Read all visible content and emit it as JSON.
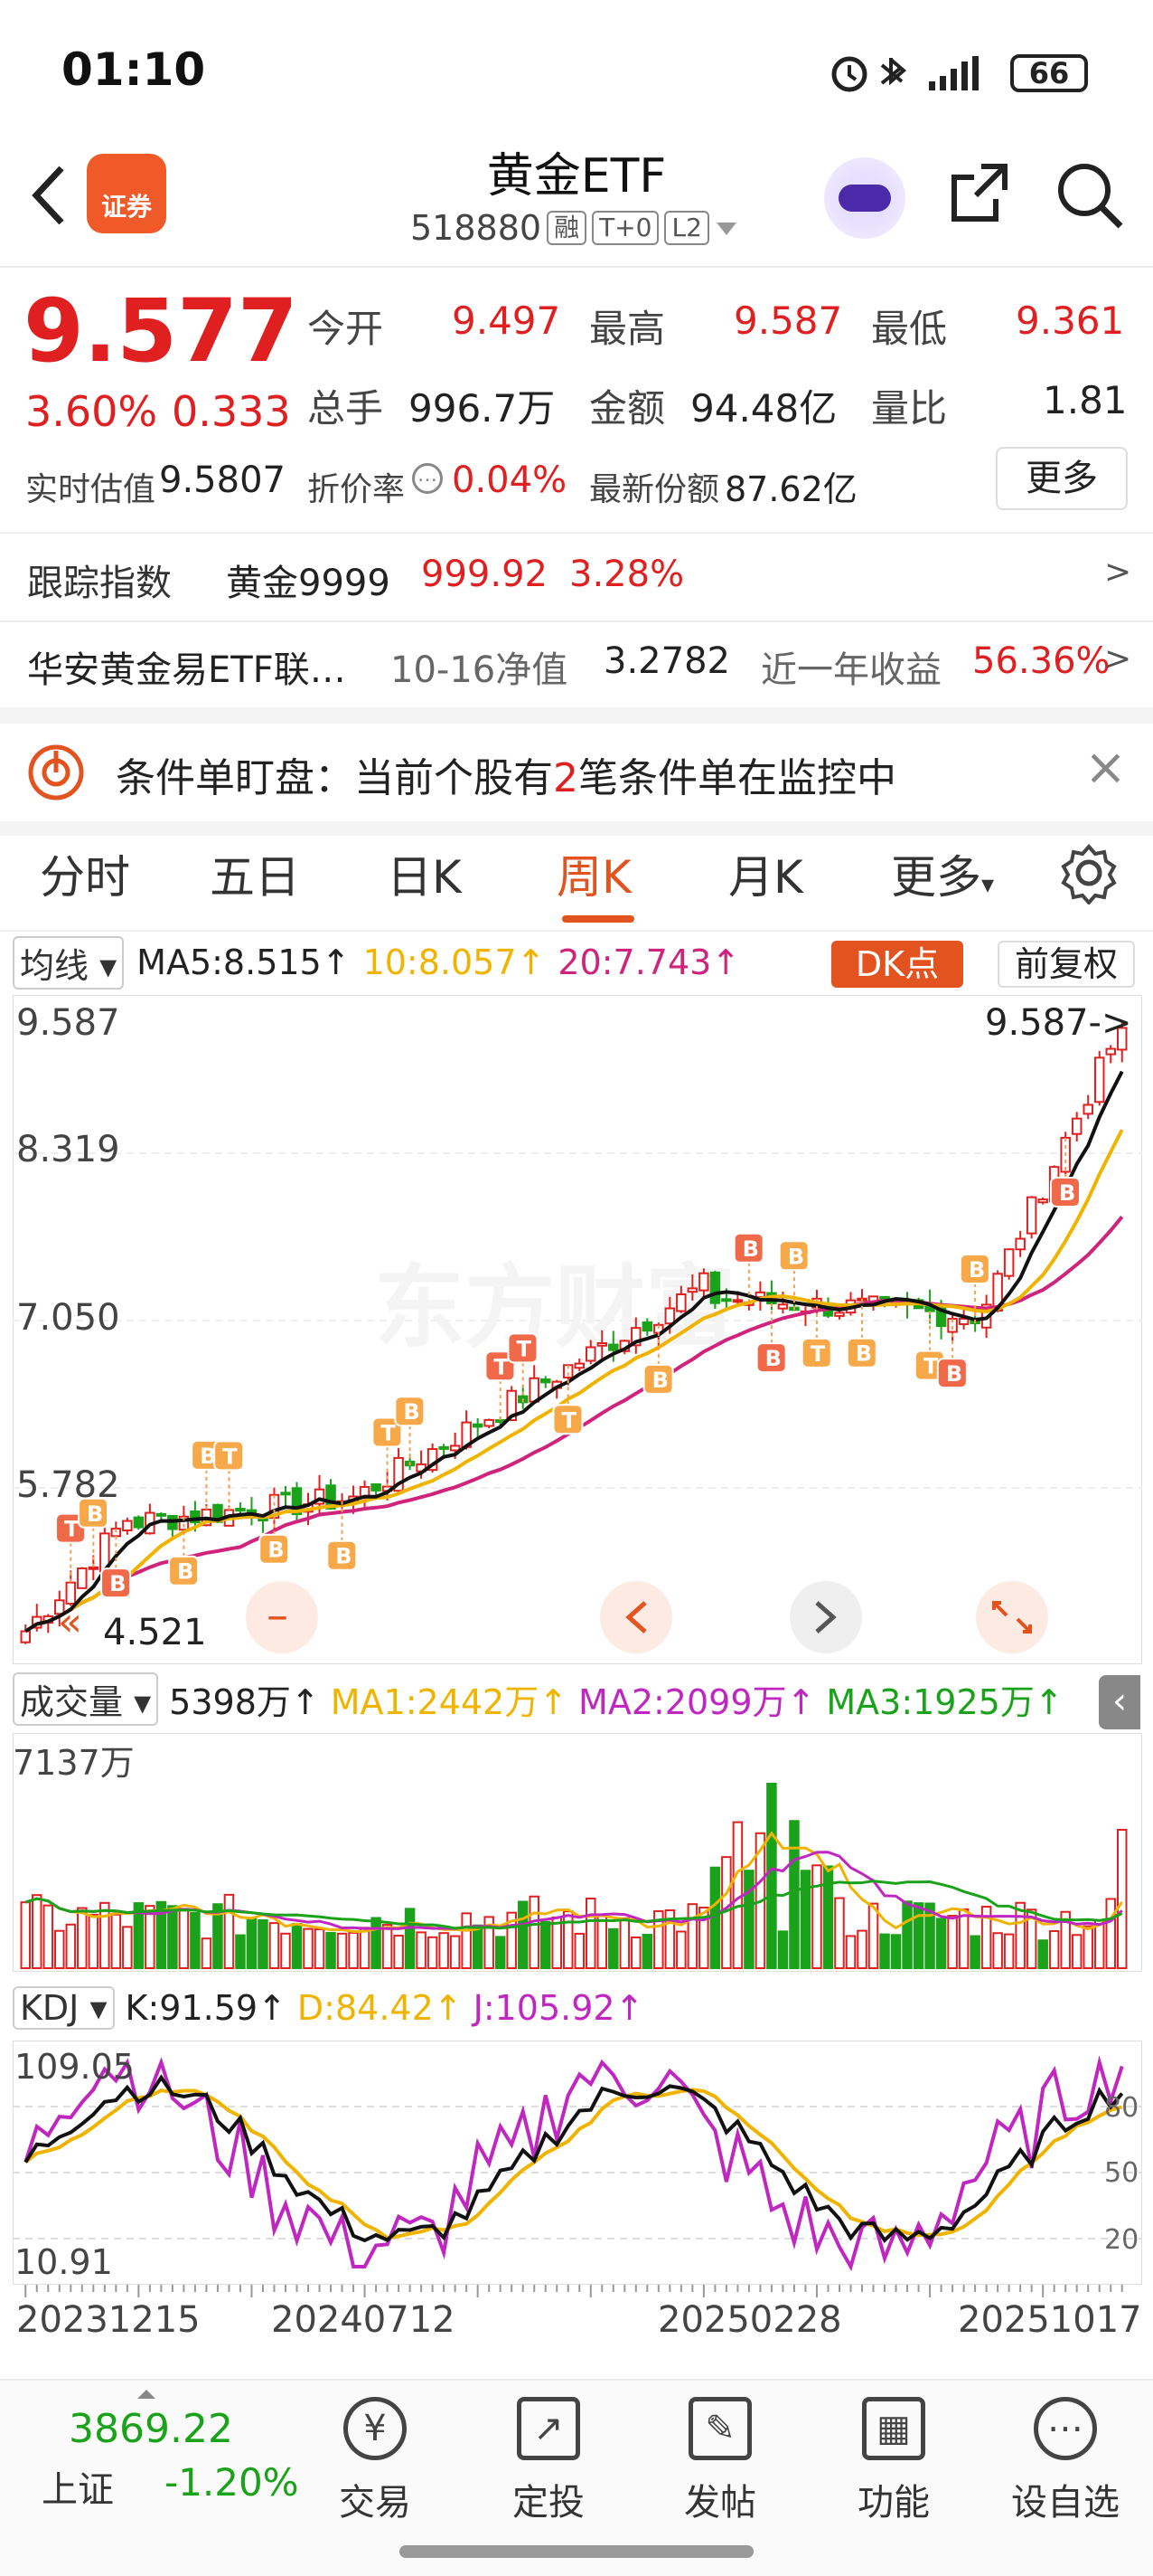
{
  "status": {
    "time": "01:10",
    "battery": "66"
  },
  "header": {
    "name": "黄金ETF",
    "code": "518880",
    "tags": [
      "融",
      "T+0",
      "L2"
    ],
    "broker_badge": "证券"
  },
  "quote": {
    "price": "9.577",
    "pct": "3.60%",
    "change": "0.333",
    "open_label": "今开",
    "open": "9.497",
    "high_label": "最高",
    "high": "9.587",
    "low_label": "最低",
    "low": "9.361",
    "vol_label": "总手",
    "vol": "996.7万",
    "amt_label": "金额",
    "amt": "94.48亿",
    "ratio_label": "量比",
    "ratio": "1.81",
    "est_label": "实时估值",
    "est": "9.5807",
    "prem_label": "折价率",
    "prem": "0.04%",
    "share_label": "最新份额",
    "share": "87.62亿",
    "more": "更多"
  },
  "track": {
    "label": "跟踪指数",
    "name": "黄金9999",
    "value": "999.92",
    "pct": "3.28%",
    "arrow": ">"
  },
  "fund": {
    "name": "华安黄金易ETF联…",
    "nav_label": "10-16净值",
    "nav": "3.2782",
    "ret_label": "近一年收益",
    "ret": "56.36%",
    "arrow": ">"
  },
  "notice": {
    "prefix": "条件单盯盘：当前个股有",
    "count": "2",
    "suffix": "笔条件单在监控中",
    "close": "×"
  },
  "tabs": [
    "分时",
    "五日",
    "日K",
    "周K",
    "月K",
    "更多"
  ],
  "active_tab": "周K",
  "ma": {
    "dropdown": "均线",
    "ma5": "MA5:8.515↑",
    "ma10": "10:8.057↑",
    "ma20": "20:7.743↑",
    "dk": "DK点",
    "fq": "前复权"
  },
  "kline": {
    "y_labels": [
      "9.587",
      "8.319",
      "7.050",
      "5.782"
    ],
    "max_note": "9.587->",
    "min_note": "4.521",
    "watermark": "东方财富"
  },
  "volume": {
    "dropdown": "成交量",
    "cur": "5398万↑",
    "ma1": "MA1:2442万↑",
    "ma2": "MA2:2099万↑",
    "ma3": "MA3:1925万↑",
    "top": "7137万"
  },
  "kdj": {
    "dropdown": "KDJ",
    "k": "K:91.59↑",
    "d": "D:84.42↑",
    "j": "J:105.92↑",
    "top": "109.05",
    "bottom": "10.91",
    "levels": [
      "80",
      "50",
      "20"
    ]
  },
  "dates": [
    "20231215",
    "20240712",
    "20250228",
    "20251017"
  ],
  "index": {
    "value": "3869.22",
    "name": "上证",
    "pct": "-1.20%"
  },
  "bottom_nav": [
    {
      "label": "交易",
      "icon": "¥"
    },
    {
      "label": "定投",
      "icon": "↗"
    },
    {
      "label": "发帖",
      "icon": "✎"
    },
    {
      "label": "功能",
      "icon": "▦"
    },
    {
      "label": "设自选",
      "icon": "⋯"
    }
  ],
  "colors": {
    "up": "#e02020",
    "down": "#1aa31a",
    "accent": "#e2531f",
    "ma5": "#111111",
    "ma10": "#f0b400",
    "ma20": "#d0237c"
  }
}
